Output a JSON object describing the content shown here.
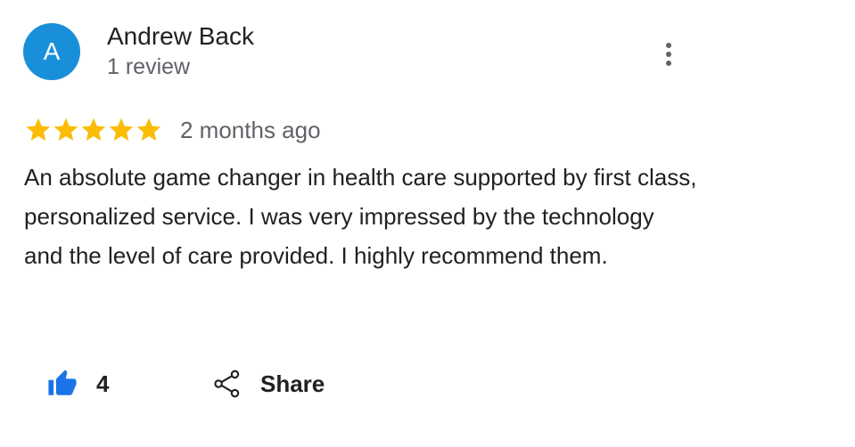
{
  "reviewer": {
    "initial": "A",
    "name": "Andrew Back",
    "review_count": "1 review",
    "avatar_color": "#1a8fd9"
  },
  "menu": {
    "icon": "more-vert-icon"
  },
  "rating": {
    "stars": 5,
    "max_stars": 5,
    "star_color": "#fbbc04",
    "date": "2 months ago"
  },
  "review": {
    "text": "An absolute game changer in health care supported by first class, personalized service. I was very impressed by the technology and the level of care provided. I highly recommend them."
  },
  "actions": {
    "like_icon": "thumbs-up-icon",
    "like_count": "4",
    "like_color": "#1a73e8",
    "share_icon": "share-icon",
    "share_label": "Share"
  }
}
